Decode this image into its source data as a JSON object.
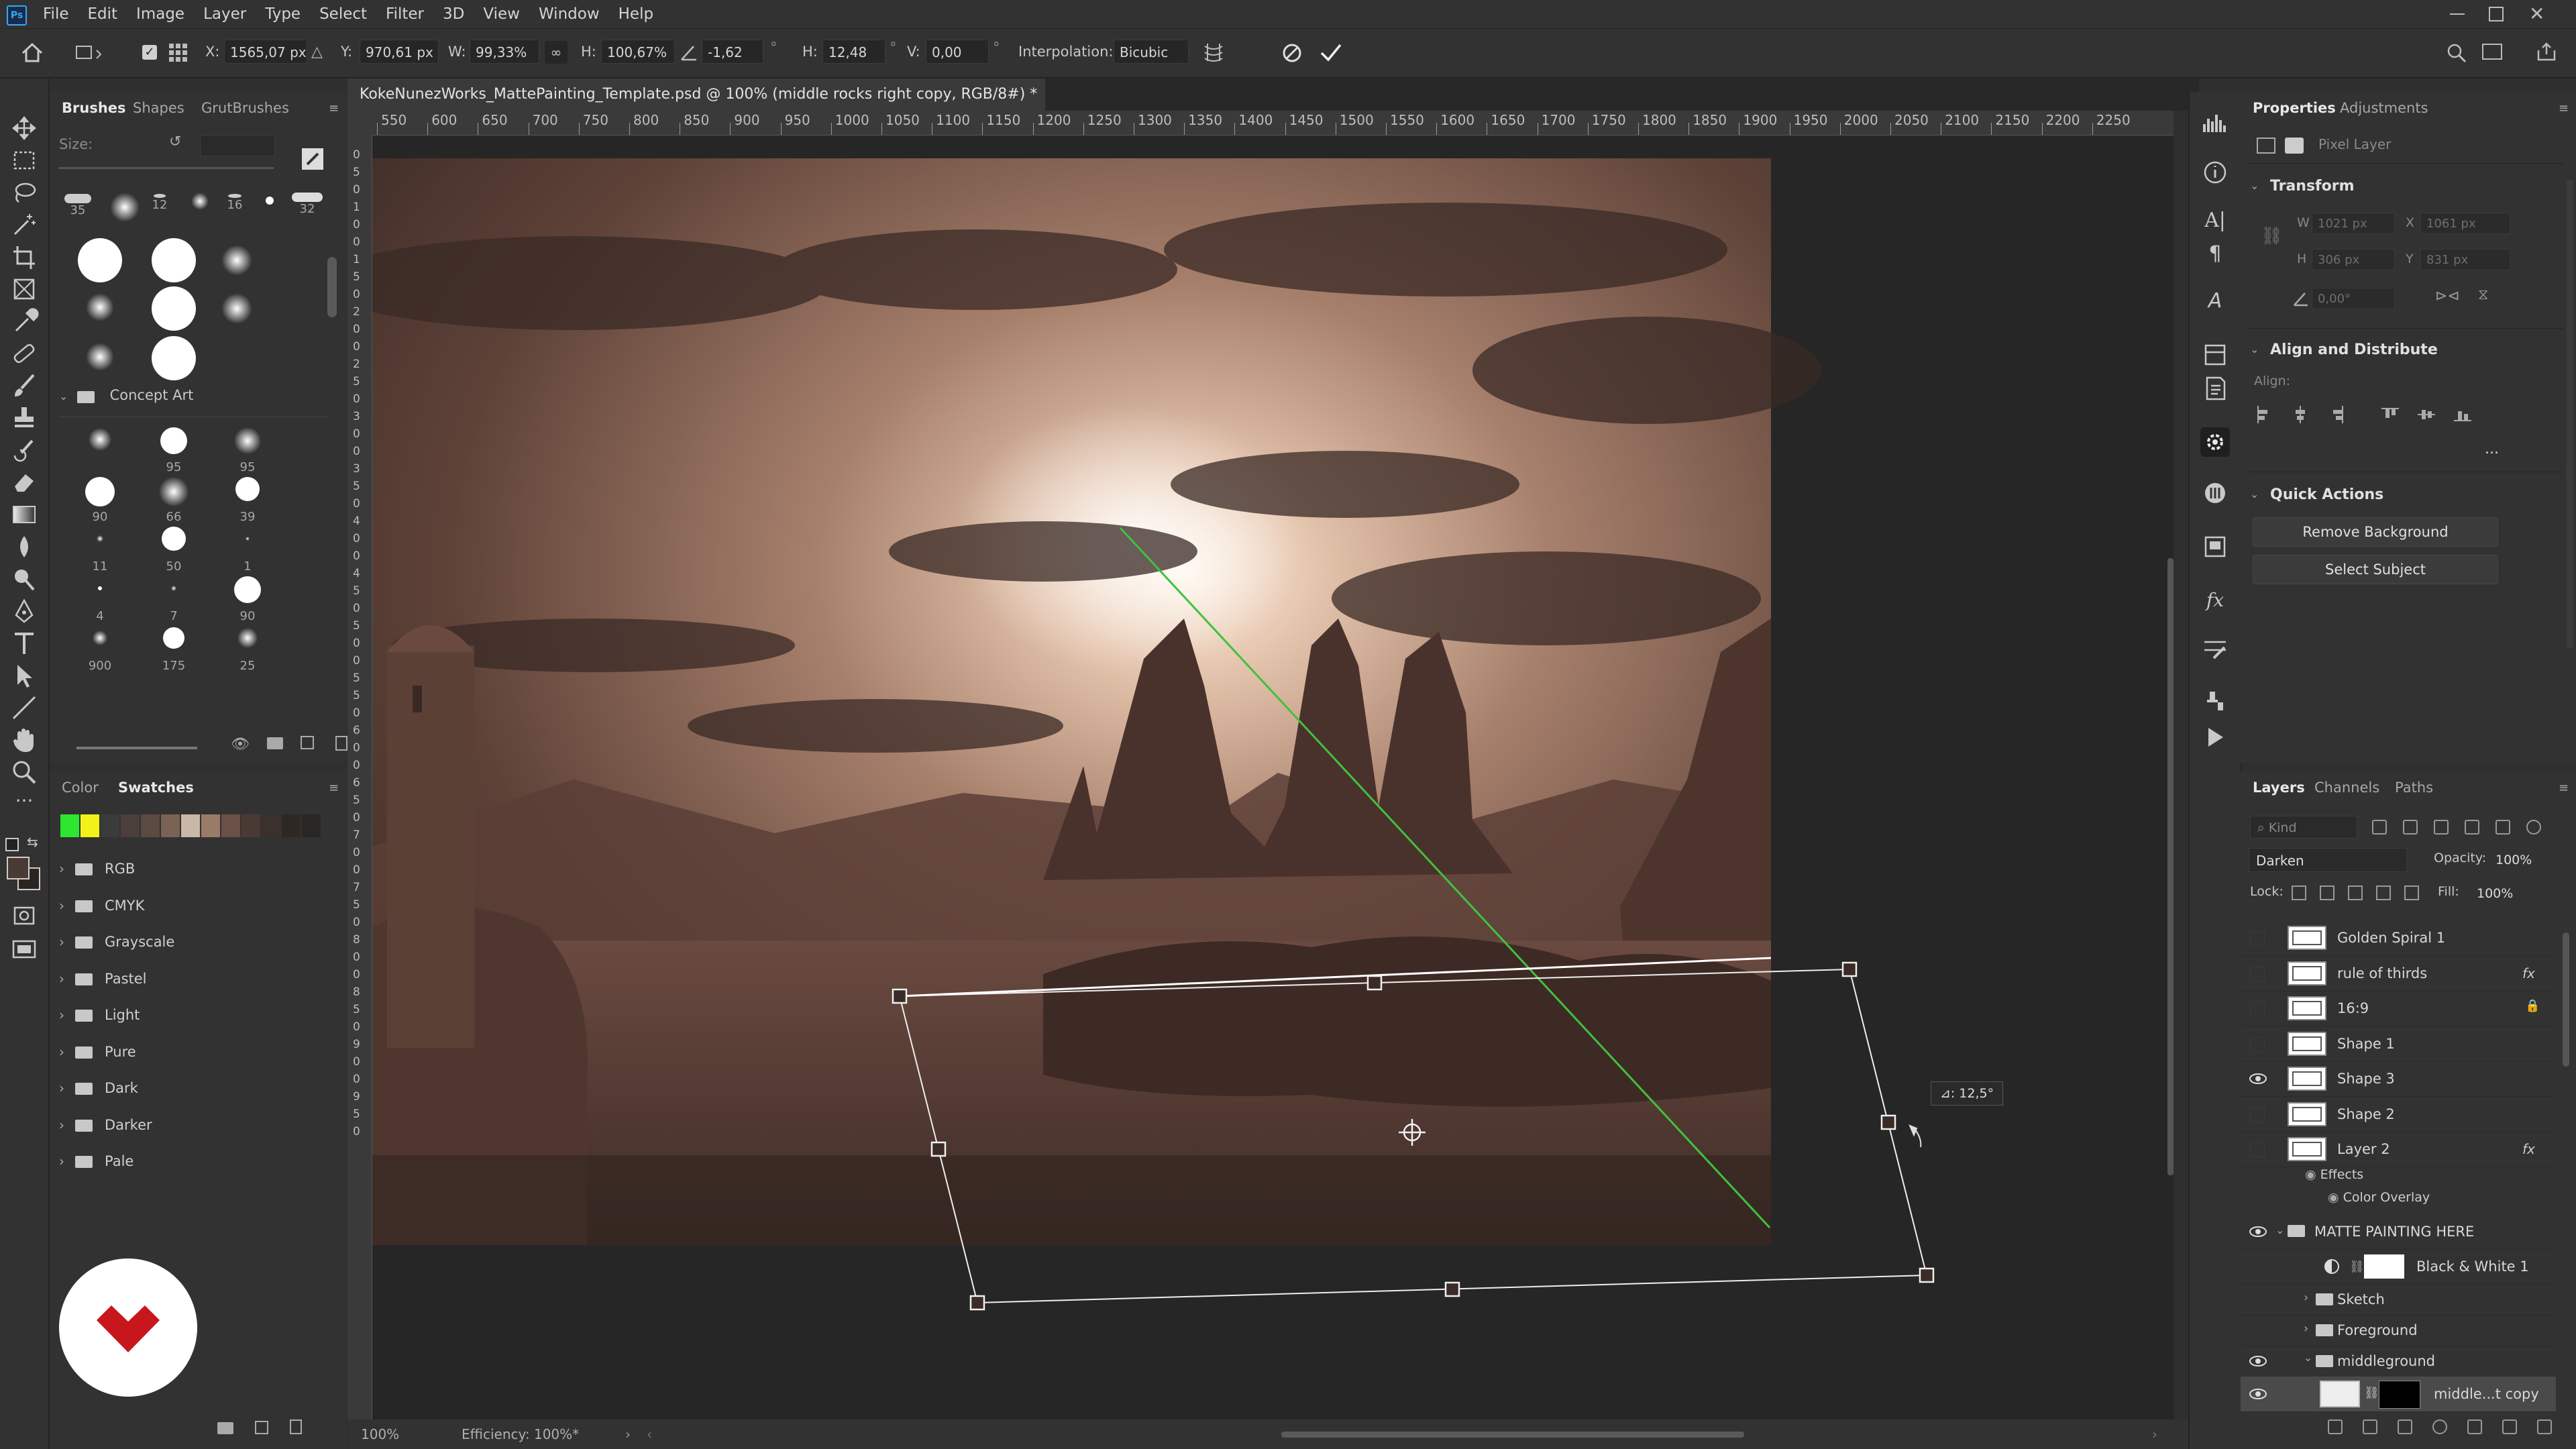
{
  "menu": [
    "File",
    "Edit",
    "Image",
    "Layer",
    "Type",
    "Select",
    "Filter",
    "3D",
    "View",
    "Window",
    "Help"
  ],
  "options": {
    "x_label": "X:",
    "x_value": "1565,07 px",
    "y_label": "Y:",
    "y_value": "970,61 px",
    "w_label": "W:",
    "w_value": "99,33%",
    "h_label": "H:",
    "h_value": "100,67%",
    "angle_value": "-1,62",
    "angle_unit": "°",
    "hskew_label": "H:",
    "hskew_value": "12,48",
    "hskew_unit": "°",
    "vskew_label": "V:",
    "vskew_value": "0,00",
    "vskew_unit": "°",
    "interp_label": "Interpolation:",
    "interp_value": "Bicubic"
  },
  "brushes": {
    "tabs": [
      "Brushes",
      "Shapes",
      "GrutBrushes"
    ],
    "size_label": "Size:",
    "top_row": [
      "35",
      "12",
      "16",
      "32"
    ],
    "group_name": "Concept Art",
    "tips": [
      [
        "",
        "95",
        "95"
      ],
      [
        "90",
        "66",
        "39"
      ],
      [
        "11",
        "50",
        "1"
      ],
      [
        "4",
        "7",
        "90"
      ],
      [
        "900",
        "175",
        "25"
      ]
    ]
  },
  "swatches": {
    "tabs": [
      "Color",
      "Swatches"
    ],
    "colors": [
      "#2ee62e",
      "#f2f21a",
      "#3b3b3b",
      "#4a3f3b",
      "#5a4a42",
      "#7a6255",
      "#c9b7a8",
      "#9a7a68",
      "#6a5046",
      "#4a3a34",
      "#3a302c",
      "#2e2825",
      "#2a2624"
    ],
    "groups": [
      "RGB",
      "CMYK",
      "Grayscale",
      "Pastel",
      "Light",
      "Pure",
      "Dark",
      "Darker",
      "Pale"
    ]
  },
  "document": {
    "tab_title": "KokeNunezWorks_MattePainting_Template.psd @ 100% (middle rocks right copy, RGB/8#) *",
    "ruler_h": [
      "550",
      "600",
      "650",
      "700",
      "750",
      "800",
      "850",
      "900",
      "950",
      "1000",
      "1050",
      "1100",
      "1150",
      "1200",
      "1250",
      "1300",
      "1350",
      "1400",
      "1450",
      "1500",
      "1550",
      "1600",
      "1650",
      "1700",
      "1750",
      "1800",
      "1850",
      "1900",
      "1950",
      "2000",
      "2050",
      "2100",
      "2150",
      "2200",
      "2250"
    ],
    "ruler_v": [
      "0",
      "5",
      "0",
      "1",
      "0",
      "0",
      "1",
      "5",
      "0",
      "2",
      "0",
      "0",
      "2",
      "5",
      "0",
      "3",
      "0",
      "0",
      "3",
      "5",
      "0",
      "4",
      "0",
      "0",
      "4",
      "5",
      "0",
      "5",
      "0",
      "0",
      "5",
      "5",
      "0",
      "6",
      "0",
      "0",
      "6",
      "5",
      "0",
      "7",
      "0",
      "0",
      "7",
      "5",
      "0",
      "8",
      "0",
      "0",
      "8",
      "5",
      "0",
      "9",
      "0",
      "0",
      "9",
      "5",
      "0"
    ],
    "angle_tooltip": "⊿: 12,5°",
    "zoom": "100%",
    "efficiency": "Efficiency: 100%*"
  },
  "properties": {
    "tabs": [
      "Properties",
      "Adjustments"
    ],
    "pixel_layer": "Pixel Layer",
    "transform_title": "Transform",
    "w": "W",
    "w_val": "1021 px",
    "x": "X",
    "x_val": "1061 px",
    "h": "H",
    "h_val": "306 px",
    "y": "Y",
    "y_val": "831 px",
    "angle_val": "0,00°",
    "align_title": "Align and Distribute",
    "align_label": "Align:",
    "more": "...",
    "quick_title": "Quick Actions",
    "btn_remove_bg": "Remove Background",
    "btn_select_subject": "Select Subject"
  },
  "layers": {
    "tabs": [
      "Layers",
      "Channels",
      "Paths"
    ],
    "kind": "Kind",
    "blend": "Darken",
    "opacity_label": "Opacity:",
    "opacity": "100%",
    "lock_label": "Lock:",
    "fill_label": "Fill:",
    "fill": "100%",
    "rows": [
      {
        "name": "Golden Spiral 1",
        "visible": false,
        "fx": false
      },
      {
        "name": "rule of thirds",
        "visible": false,
        "fx": true
      },
      {
        "name": "16:9",
        "visible": false,
        "fx": false
      },
      {
        "name": "Shape 1",
        "visible": false,
        "fx": false
      },
      {
        "name": "Shape 3",
        "visible": true,
        "fx": false
      },
      {
        "name": "Shape 2",
        "visible": false,
        "fx": false
      },
      {
        "name": "Layer 2",
        "visible": false,
        "fx": true
      }
    ],
    "effects": "Effects",
    "color_overlay": "Color Overlay",
    "group_matte": "MATTE PAINTING HERE",
    "bw": "Black & White 1",
    "sketch": "Sketch",
    "foreground": "Foreground",
    "middleground": "middleground",
    "selected_layer": "middle...t copy"
  }
}
